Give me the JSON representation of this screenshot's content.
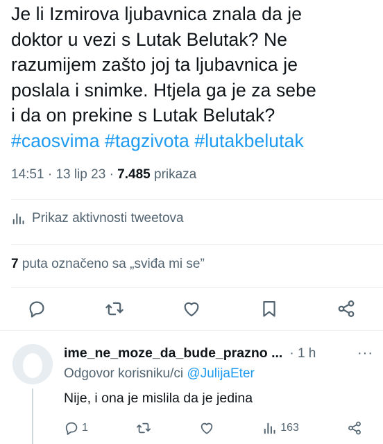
{
  "tweet": {
    "text_lines": [
      "Je li Izmirova ljubavnica znala da je",
      "doktor u vezi s Lutak Belutak? Ne",
      "razumijem zašto joj ta ljubavnica je",
      "poslala i snimke. Htjela ga je za sebe",
      "i da on prekine s Lutak Belutak?"
    ],
    "hashtags": [
      "#caosvima",
      "#tagzivota",
      "#lutakbelutak"
    ],
    "time": "14:51",
    "date": "13 lip 23",
    "separator": "·",
    "views_count": "7.485",
    "views_label": "prikaza"
  },
  "activity": {
    "label": "Prikaz aktivnosti tweetova",
    "icon": "analytics-icon"
  },
  "likes": {
    "count": "7",
    "label": "puta označeno sa „sviđa mi se”"
  },
  "actions": [
    {
      "name": "reply-button",
      "icon": "reply-icon"
    },
    {
      "name": "retweet-button",
      "icon": "retweet-icon"
    },
    {
      "name": "like-button",
      "icon": "heart-icon"
    },
    {
      "name": "bookmark-button",
      "icon": "bookmark-icon"
    },
    {
      "name": "share-button",
      "icon": "share-icon"
    }
  ],
  "reply": {
    "name": "ime_ne_moze_da_bude_prazno ...",
    "time": "· 1 h",
    "more": "···",
    "reply_to_label": "Odgovor korisniku/ci",
    "reply_to_handle": "@JulijaEter",
    "text": "Nije, i ona je mislila da je jedina",
    "reply_count": "1",
    "views_count": "163"
  },
  "colors": {
    "accent": "#1d9bf0",
    "text": "#0f1419",
    "secondary": "#536471",
    "divider": "#eff3f4"
  }
}
